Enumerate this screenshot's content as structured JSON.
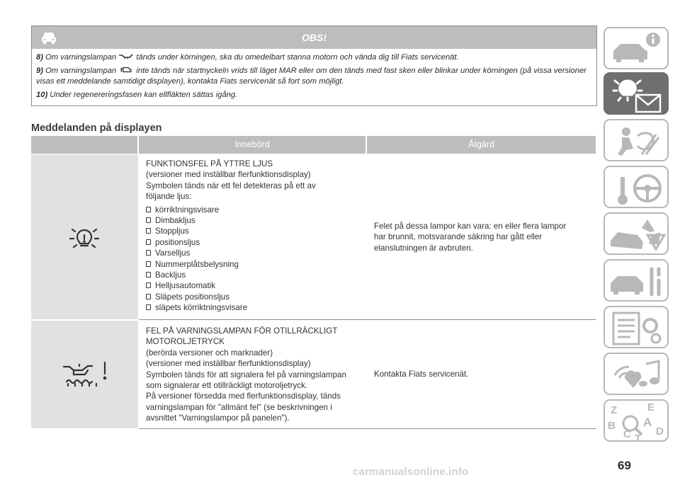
{
  "obs": {
    "title": "OBS!",
    "notes": [
      {
        "num": "8)",
        "pre": "Om varningslampan",
        "post": "tänds under körningen, ska du omedelbart stanna motorn och vända dig till Fiats servicenät."
      },
      {
        "num": "9)",
        "pre": "Om varningslampan",
        "post": "inte tänds när startnyckeln vrids till läget MAR eller om den tänds med fast sken eller blinkar under körningen (på vissa versioner visas ett meddelande samtidigt displayen), kontakta Fiats servicenät så fort som möjligt."
      },
      {
        "num": "10)",
        "text": "Under regenereringsfasen kan ellfläkten sättas igång."
      }
    ]
  },
  "section_title": "Meddelanden på displayen",
  "table": {
    "headers": [
      "Innebörd",
      "Åtgärd"
    ],
    "rows": [
      {
        "icon": "bulb-fault-icon",
        "desc_lines": [
          "FUNKTIONSFEL PÅ YTTRE LJUS",
          "(versioner med inställbar flerfunktionsdisplay)",
          "Symbolen tänds när ett fel detekteras på ett av",
          "följande ljus:"
        ],
        "bullets": [
          "körriktningsvisare",
          "Dimbakljus",
          "Stoppljus",
          "positionsljus",
          "Varselljus",
          "Nummerplåtsbelysning",
          "Backljus",
          "Helljusautomatik",
          "Släpets positionsljus",
          "släpets körriktningsvisare"
        ],
        "action_lines": [
          "Felet på dessa lampor kan vara: en eller flera lampor",
          "har brunnit, motsvarande säkring har gått eller",
          "elanslutningen är avbruten."
        ]
      },
      {
        "icon": "oil-level-warning-icon",
        "desc_lines": [
          "FEL PÅ VARNINGSLAMPAN FÖR OTILLRÄCKLIGT",
          "MOTOROLJETRYCK",
          "(berörda versioner och marknader)",
          "(versioner med inställbar flerfunktionsdisplay)",
          "Symbolen tänds för att signalera fel på varningslampan",
          "som signalerar ett otillräckligt motoroljetryck.",
          "På versioner försedda med flerfunktionsdisplay, tänds",
          "varningslampan för \"allmänt fel\" (se beskrivningen i",
          "avsnittet \"Varningslampor på panelen\")."
        ],
        "action_lines": [
          "Kontakta Fiats servicenät."
        ]
      }
    ]
  },
  "side_tabs": [
    {
      "icon": "car-info-icon",
      "active": false
    },
    {
      "icon": "warning-lights-message-icon",
      "active": true
    },
    {
      "icon": "airbag-seat-icon",
      "active": false
    },
    {
      "icon": "key-steering-wheel-icon",
      "active": false
    },
    {
      "icon": "car-breakdown-icon",
      "active": false
    },
    {
      "icon": "car-maintenance-icon",
      "active": false
    },
    {
      "icon": "list-settings-icon",
      "active": false
    },
    {
      "icon": "multimedia-icon",
      "active": false
    },
    {
      "icon": "alphabetical-index-icon",
      "active": false
    }
  ],
  "index_letters": [
    "Z",
    "E",
    "B",
    "A",
    "C",
    "D",
    "T"
  ],
  "page_number": "69",
  "watermark": "carmanualsonline.info"
}
